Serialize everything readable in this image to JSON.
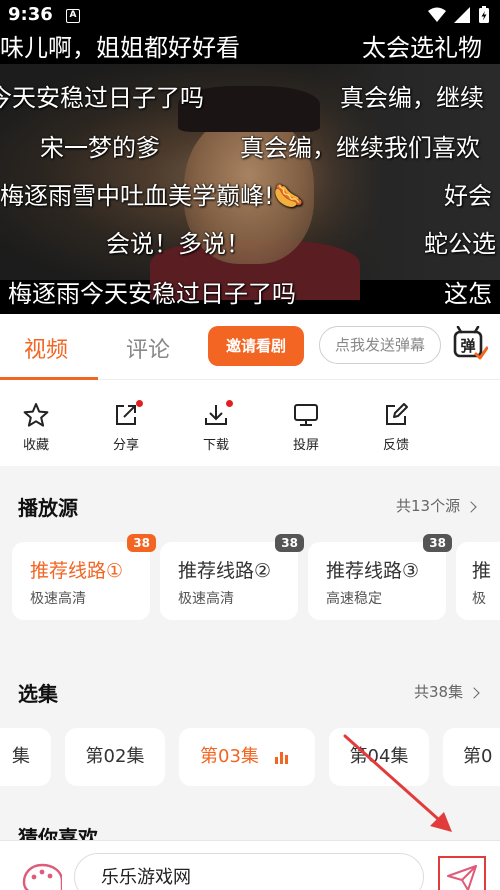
{
  "status_bar": {
    "time": "9:36",
    "notification_badge": "A"
  },
  "video": {
    "danmaku": [
      "味儿啊，姐姐都好好看",
      "太会选礼物",
      "今天安稳过日子了吗",
      "真会编，继续",
      "宋一梦的爹",
      "真会编，继续我们喜欢",
      "梅逐雨雪中吐血美学巅峰!🌭",
      "好会",
      "会说！多说！",
      "蛇公选",
      "梅逐雨今天安稳过日子了吗",
      "这怎"
    ]
  },
  "tabs": {
    "video": "视频",
    "comments": "评论",
    "invite_button": "邀请看剧",
    "danmu_placeholder": "点我发送弹幕",
    "danmu_toggle": "弹"
  },
  "actions": [
    {
      "label": "收藏",
      "icon": "star-icon"
    },
    {
      "label": "分享",
      "icon": "share-icon",
      "dot": true
    },
    {
      "label": "下载",
      "icon": "download-icon",
      "dot": true
    },
    {
      "label": "投屏",
      "icon": "cast-icon"
    },
    {
      "label": "反馈",
      "icon": "feedback-icon"
    }
  ],
  "sources": {
    "title": "播放源",
    "more": "共13个源",
    "items": [
      {
        "name": "推荐线路①",
        "speed": "极速高清",
        "count": "38",
        "selected": true
      },
      {
        "name": "推荐线路②",
        "speed": "极速高清",
        "count": "38"
      },
      {
        "name": "推荐线路③",
        "speed": "高速稳定",
        "count": "38"
      },
      {
        "name": "推",
        "speed": "极"
      }
    ]
  },
  "episodes": {
    "title": "选集",
    "more": "共38集",
    "items": [
      {
        "label": "集"
      },
      {
        "label": "第02集"
      },
      {
        "label": "第03集",
        "selected": true
      },
      {
        "label": "第04集"
      },
      {
        "label": "第0"
      }
    ]
  },
  "recommend": {
    "title": "猜你喜欢"
  },
  "comment_bar": {
    "value": "乐乐游戏网"
  },
  "colors": {
    "accent": "#f26522",
    "highlight_box": "#e23b3b"
  }
}
